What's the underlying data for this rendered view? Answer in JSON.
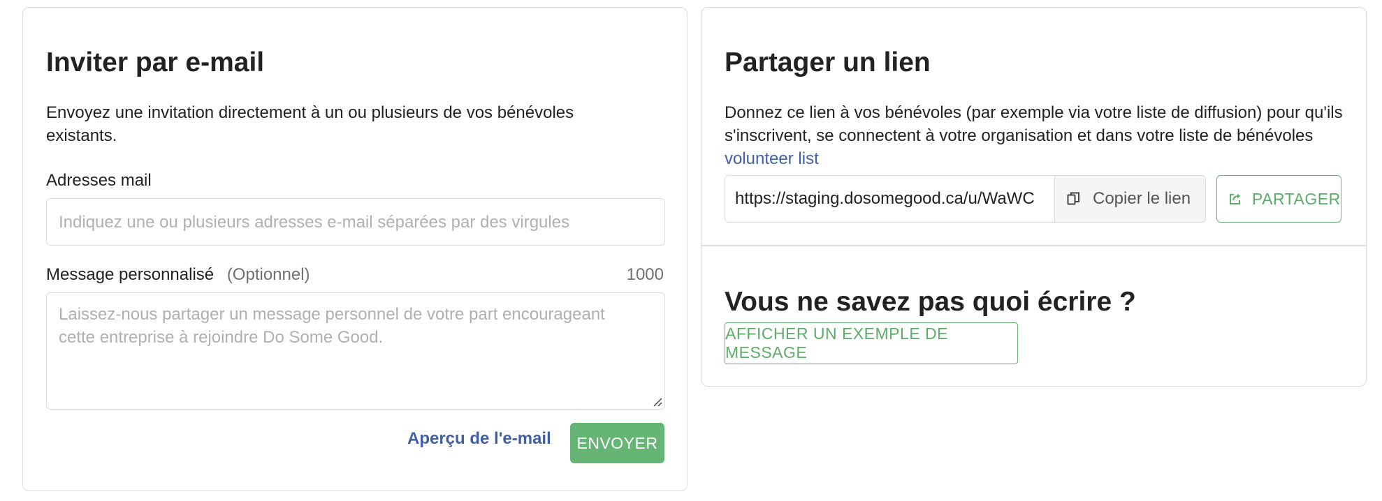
{
  "invite": {
    "title": "Inviter par e-mail",
    "description": "Envoyez une invitation directement à un ou plusieurs de vos bénévoles existants.",
    "email_label": "Adresses mail",
    "email_placeholder": "Indiquez une ou plusieurs adresses e-mail séparées par des virgules",
    "message_label": "Message personnalisé",
    "message_optional": "(Optionnel)",
    "message_char_count": "1000",
    "message_placeholder": "Laissez-nous partager un message personnel de votre part encourageant cette entreprise à rejoindre Do Some Good.",
    "preview_label": "Aperçu de l'e-mail",
    "send_label": "ENVOYER"
  },
  "share": {
    "title": "Partager un lien",
    "description": "Donnez ce lien à vos bénévoles (par exemple via votre liste de diffusion) pour qu'ils s'inscrivent, se connectent à votre organisation et dans votre liste de bénévoles",
    "description_link": "volunteer list",
    "url": "https://staging.dosomegood.ca/u/WaWC",
    "copy_label": "Copier le lien",
    "share_label": "PARTAGER",
    "copy_icon": "copy-icon",
    "share_icon": "share-icon"
  },
  "help": {
    "title": "Vous ne savez pas quoi écrire ?",
    "example_label": "AFFICHER UN EXEMPLE DE MESSAGE"
  },
  "colors": {
    "accent_green": "#67b575",
    "link_blue": "#3f5fa6",
    "border": "#dcdcdc",
    "placeholder": "#b0b0b0"
  }
}
